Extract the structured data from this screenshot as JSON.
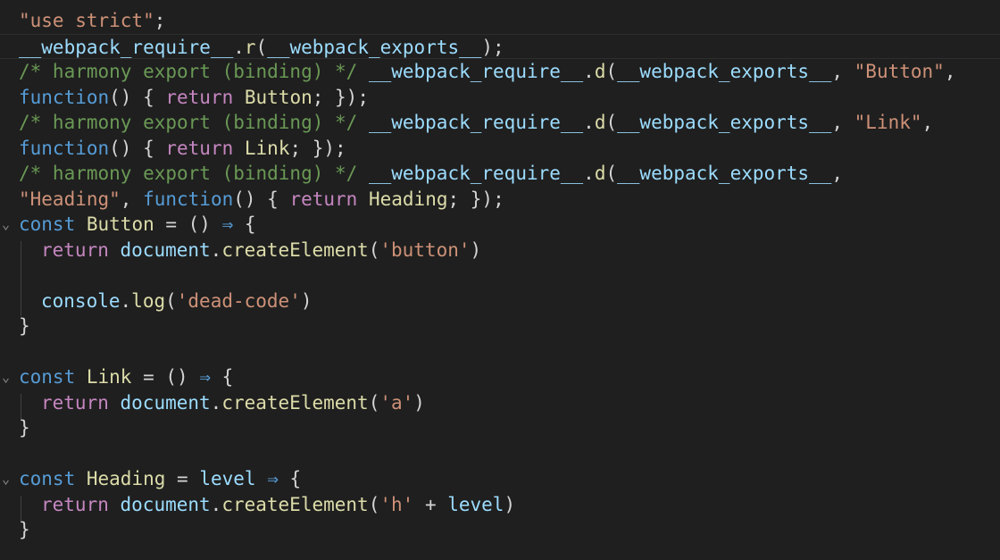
{
  "editor": {
    "lines": [
      {
        "fold": "",
        "indent": false,
        "tokens": [
          {
            "t": "str",
            "v": "\"use strict\""
          },
          {
            "t": "pun",
            "v": ";"
          }
        ]
      },
      {
        "fold": "",
        "indent": false,
        "tokens": [
          {
            "t": "var",
            "v": "__webpack_require__"
          },
          {
            "t": "pun",
            "v": "."
          },
          {
            "t": "fn",
            "v": "r"
          },
          {
            "t": "pun",
            "v": "("
          },
          {
            "t": "var",
            "v": "__webpack_exports__"
          },
          {
            "t": "pun",
            "v": ");"
          }
        ]
      },
      {
        "fold": "",
        "indent": false,
        "tokens": [
          {
            "t": "cmt",
            "v": "/* harmony export (binding) */"
          },
          {
            "t": "pun",
            "v": " "
          },
          {
            "t": "var",
            "v": "__webpack_require__"
          },
          {
            "t": "pun",
            "v": "."
          },
          {
            "t": "fn",
            "v": "d"
          },
          {
            "t": "pun",
            "v": "("
          },
          {
            "t": "var",
            "v": "__webpack_exports__"
          },
          {
            "t": "pun",
            "v": ", "
          },
          {
            "t": "str",
            "v": "\"Button\""
          },
          {
            "t": "pun",
            "v": ","
          }
        ]
      },
      {
        "fold": "",
        "indent": false,
        "tokens": [
          {
            "t": "kw",
            "v": "function"
          },
          {
            "t": "pun",
            "v": "() { "
          },
          {
            "t": "ctl",
            "v": "return"
          },
          {
            "t": "pun",
            "v": " "
          },
          {
            "t": "cls",
            "v": "Button"
          },
          {
            "t": "pun",
            "v": "; });"
          }
        ]
      },
      {
        "fold": "",
        "indent": false,
        "tokens": [
          {
            "t": "cmt",
            "v": "/* harmony export (binding) */"
          },
          {
            "t": "pun",
            "v": " "
          },
          {
            "t": "var",
            "v": "__webpack_require__"
          },
          {
            "t": "pun",
            "v": "."
          },
          {
            "t": "fn",
            "v": "d"
          },
          {
            "t": "pun",
            "v": "("
          },
          {
            "t": "var",
            "v": "__webpack_exports__"
          },
          {
            "t": "pun",
            "v": ", "
          },
          {
            "t": "str",
            "v": "\"Link\""
          },
          {
            "t": "pun",
            "v": ","
          }
        ]
      },
      {
        "fold": "",
        "indent": false,
        "tokens": [
          {
            "t": "kw",
            "v": "function"
          },
          {
            "t": "pun",
            "v": "() { "
          },
          {
            "t": "ctl",
            "v": "return"
          },
          {
            "t": "pun",
            "v": " "
          },
          {
            "t": "cls",
            "v": "Link"
          },
          {
            "t": "pun",
            "v": "; });"
          }
        ]
      },
      {
        "fold": "",
        "indent": false,
        "tokens": [
          {
            "t": "cmt",
            "v": "/* harmony export (binding) */"
          },
          {
            "t": "pun",
            "v": " "
          },
          {
            "t": "var",
            "v": "__webpack_require__"
          },
          {
            "t": "pun",
            "v": "."
          },
          {
            "t": "fn",
            "v": "d"
          },
          {
            "t": "pun",
            "v": "("
          },
          {
            "t": "var",
            "v": "__webpack_exports__"
          },
          {
            "t": "pun",
            "v": ","
          }
        ]
      },
      {
        "fold": "",
        "indent": false,
        "tokens": [
          {
            "t": "str",
            "v": "\"Heading\""
          },
          {
            "t": "pun",
            "v": ", "
          },
          {
            "t": "kw",
            "v": "function"
          },
          {
            "t": "pun",
            "v": "() { "
          },
          {
            "t": "ctl",
            "v": "return"
          },
          {
            "t": "pun",
            "v": " "
          },
          {
            "t": "cls",
            "v": "Heading"
          },
          {
            "t": "pun",
            "v": "; });"
          }
        ]
      },
      {
        "fold": "⌄",
        "indent": false,
        "tokens": [
          {
            "t": "kw",
            "v": "const"
          },
          {
            "t": "pun",
            "v": " "
          },
          {
            "t": "cls",
            "v": "Button"
          },
          {
            "t": "pun",
            "v": " = () "
          },
          {
            "t": "arrow",
            "v": "⇒"
          },
          {
            "t": "pun",
            "v": " {"
          }
        ]
      },
      {
        "fold": "",
        "indent": true,
        "tokens": [
          {
            "t": "ctl",
            "v": "return"
          },
          {
            "t": "pun",
            "v": " "
          },
          {
            "t": "var",
            "v": "document"
          },
          {
            "t": "pun",
            "v": "."
          },
          {
            "t": "fn",
            "v": "createElement"
          },
          {
            "t": "pun",
            "v": "("
          },
          {
            "t": "str",
            "v": "'button'"
          },
          {
            "t": "pun",
            "v": ")"
          }
        ]
      },
      {
        "fold": "",
        "indent": true,
        "tokens": []
      },
      {
        "fold": "",
        "indent": true,
        "tokens": [
          {
            "t": "var",
            "v": "console"
          },
          {
            "t": "pun",
            "v": "."
          },
          {
            "t": "fn",
            "v": "log"
          },
          {
            "t": "pun",
            "v": "("
          },
          {
            "t": "str",
            "v": "'dead-code'"
          },
          {
            "t": "pun",
            "v": ")"
          }
        ]
      },
      {
        "fold": "",
        "indent": false,
        "tokens": [
          {
            "t": "pun",
            "v": "}"
          }
        ]
      },
      {
        "fold": "",
        "indent": false,
        "tokens": []
      },
      {
        "fold": "⌄",
        "indent": false,
        "tokens": [
          {
            "t": "kw",
            "v": "const"
          },
          {
            "t": "pun",
            "v": " "
          },
          {
            "t": "cls",
            "v": "Link"
          },
          {
            "t": "pun",
            "v": " = () "
          },
          {
            "t": "arrow",
            "v": "⇒"
          },
          {
            "t": "pun",
            "v": " {"
          }
        ]
      },
      {
        "fold": "",
        "indent": true,
        "tokens": [
          {
            "t": "ctl",
            "v": "return"
          },
          {
            "t": "pun",
            "v": " "
          },
          {
            "t": "var",
            "v": "document"
          },
          {
            "t": "pun",
            "v": "."
          },
          {
            "t": "fn",
            "v": "createElement"
          },
          {
            "t": "pun",
            "v": "("
          },
          {
            "t": "str",
            "v": "'a'"
          },
          {
            "t": "pun",
            "v": ")"
          }
        ]
      },
      {
        "fold": "",
        "indent": false,
        "tokens": [
          {
            "t": "pun",
            "v": "}"
          }
        ]
      },
      {
        "fold": "",
        "indent": false,
        "tokens": []
      },
      {
        "fold": "⌄",
        "indent": false,
        "tokens": [
          {
            "t": "kw",
            "v": "const"
          },
          {
            "t": "pun",
            "v": " "
          },
          {
            "t": "cls",
            "v": "Heading"
          },
          {
            "t": "pun",
            "v": " = "
          },
          {
            "t": "var",
            "v": "level"
          },
          {
            "t": "pun",
            "v": " "
          },
          {
            "t": "arrow",
            "v": "⇒"
          },
          {
            "t": "pun",
            "v": " {"
          }
        ]
      },
      {
        "fold": "",
        "indent": true,
        "tokens": [
          {
            "t": "ctl",
            "v": "return"
          },
          {
            "t": "pun",
            "v": " "
          },
          {
            "t": "var",
            "v": "document"
          },
          {
            "t": "pun",
            "v": "."
          },
          {
            "t": "fn",
            "v": "createElement"
          },
          {
            "t": "pun",
            "v": "("
          },
          {
            "t": "str",
            "v": "'h'"
          },
          {
            "t": "pun",
            "v": " + "
          },
          {
            "t": "var",
            "v": "level"
          },
          {
            "t": "pun",
            "v": ")"
          }
        ]
      },
      {
        "fold": "",
        "indent": false,
        "tokens": [
          {
            "t": "pun",
            "v": "}"
          }
        ]
      }
    ]
  },
  "colors": {
    "background": "#1f1f1f",
    "string": "#ce9178",
    "comment": "#6a9955",
    "variable": "#9cdcfe",
    "function": "#dcdcaa",
    "keyword": "#569cd6",
    "control": "#c586c0"
  }
}
